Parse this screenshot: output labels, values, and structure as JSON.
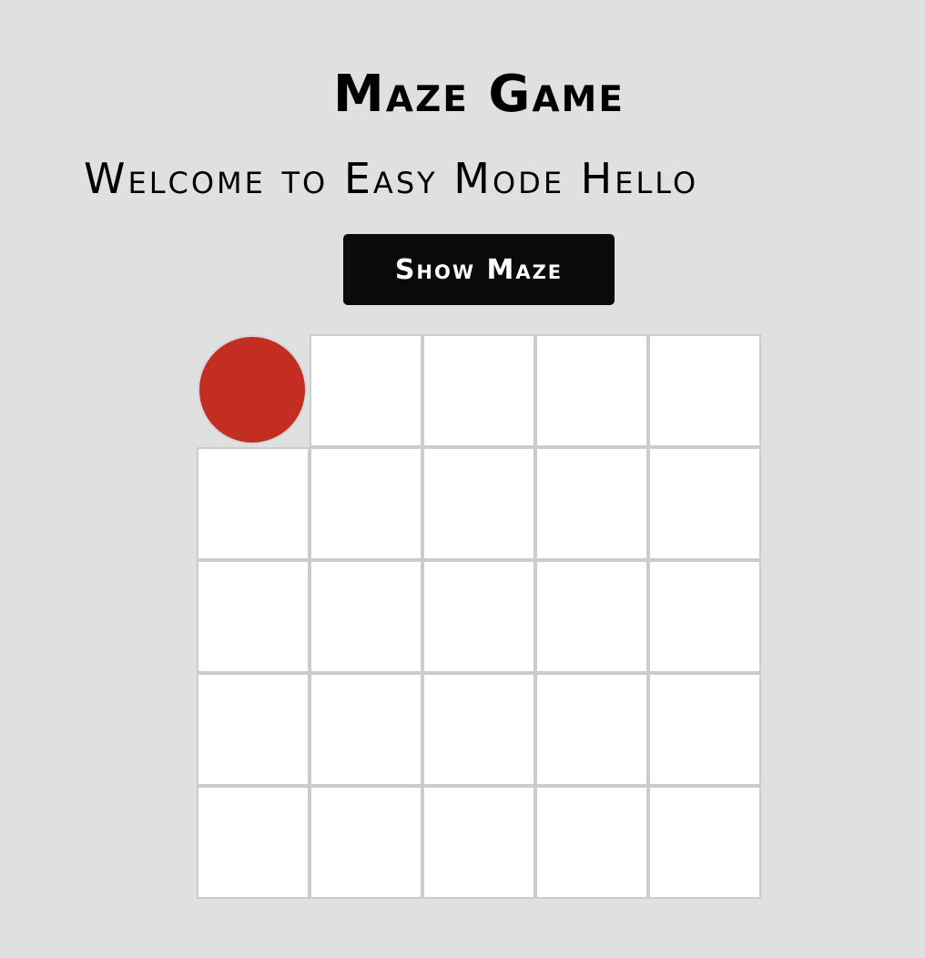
{
  "header": {
    "title": "Maze Game"
  },
  "welcome": {
    "text": "Welcome to Easy Mode Hello"
  },
  "controls": {
    "show_maze_label": "Show Maze"
  },
  "maze": {
    "rows": 5,
    "cols": 5,
    "player": {
      "row": 0,
      "col": 0
    },
    "colors": {
      "background": "#e0e0e0",
      "cell": "#ffffff",
      "cell_border": "#cccccc",
      "player": "#c42d22",
      "button": "#0a0a0a"
    }
  }
}
